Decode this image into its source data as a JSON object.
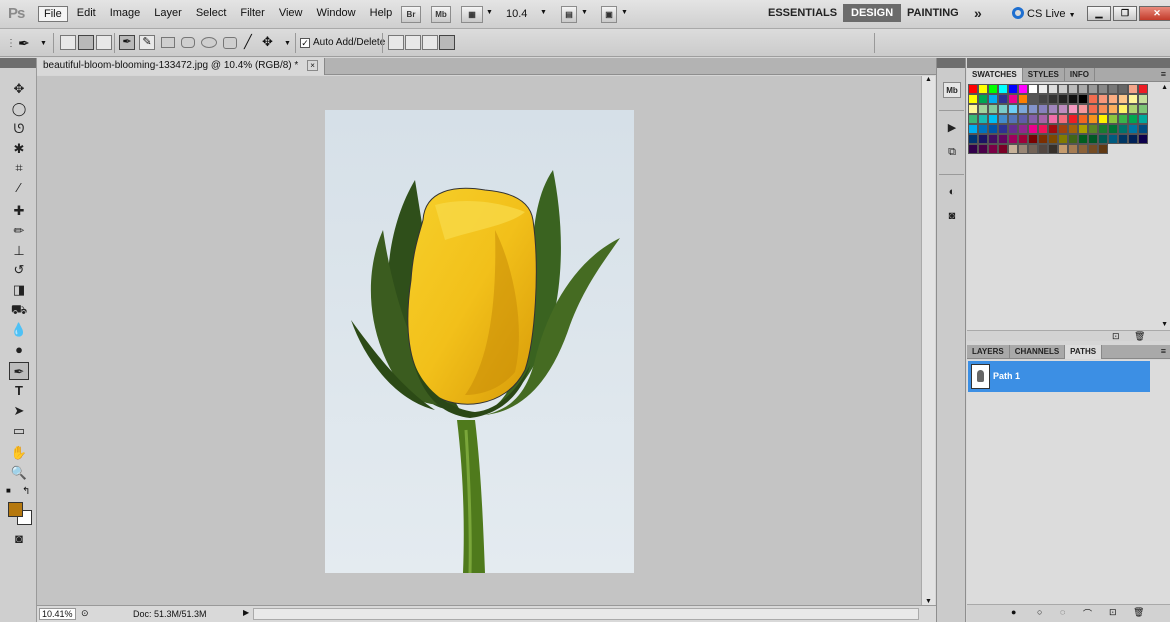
{
  "menu": {
    "items": [
      "File",
      "Edit",
      "Image",
      "Layer",
      "Select",
      "Filter",
      "View",
      "Window",
      "Help"
    ],
    "bridge_label": "Br",
    "minibridge_label": "Mb",
    "zoom_value": "10.4"
  },
  "workspaces": {
    "essentials": "ESSENTIALS",
    "design": "DESIGN",
    "painting": "PAINTING",
    "more": "»"
  },
  "cslive": {
    "label": "CS Live"
  },
  "options": {
    "auto_add_label": "Auto Add/Delete",
    "auto_add_checked": true
  },
  "document": {
    "tab_title": "beautiful-bloom-blooming-133472.jpg @ 10.4% (RGB/8) *",
    "close_label": "×"
  },
  "status": {
    "zoom": "10.41%",
    "doc_size": "Doc: 51.3M/51.3M"
  },
  "colors": {
    "foreground": "#b5780e",
    "background": "#ffffff",
    "selection": "#3c8fe4"
  },
  "swatches_panel": {
    "tabs": [
      "SWATCHES",
      "STYLES",
      "INFO"
    ],
    "active": "SWATCHES"
  },
  "paths_panel": {
    "tabs": [
      "LAYERS",
      "CHANNELS",
      "PATHS"
    ],
    "active": "PATHS",
    "paths": [
      "Path 1"
    ]
  },
  "swatch_colors": [
    "#ff0000",
    "#ffff00",
    "#00ff00",
    "#00ffff",
    "#0000ff",
    "#ff00ff",
    "#ffffff",
    "#eeeeee",
    "#dddddd",
    "#cccccc",
    "#bbbbbb",
    "#aaaaaa",
    "#999999",
    "#888888",
    "#777777",
    "#666666",
    "#f4a58a",
    "#ed1c24",
    "#ffff00",
    "#00a651",
    "#00aeef",
    "#2e3192",
    "#ec008c",
    "#ff7f00",
    "#555555",
    "#444444",
    "#333333",
    "#222222",
    "#111111",
    "#000000",
    "#f26c4f",
    "#f7977a",
    "#fbad82",
    "#fdc68a",
    "#fff79a",
    "#c4df9b",
    "#fff799",
    "#a3d39c",
    "#82ca9d",
    "#7accc8",
    "#6dcff6",
    "#7da7d9",
    "#8393ca",
    "#8781bd",
    "#a186be",
    "#bd8cbf",
    "#f49ac1",
    "#f5989d",
    "#f26c4f",
    "#f68e56",
    "#fbaf5d",
    "#fff467",
    "#acd372",
    "#7cc576",
    "#3bb878",
    "#1abbb4",
    "#00bff3",
    "#438ccb",
    "#5574b9",
    "#605ca8",
    "#855fa8",
    "#a763a8",
    "#f06eaa",
    "#f26d7d",
    "#ed1c24",
    "#f26522",
    "#f7941d",
    "#fff200",
    "#8dc63f",
    "#39b54a",
    "#00a651",
    "#00a99d",
    "#00aeef",
    "#0072bc",
    "#0054a6",
    "#2e3192",
    "#662d91",
    "#92278f",
    "#ec008c",
    "#ed145b",
    "#9e0b0f",
    "#a0410d",
    "#a3620a",
    "#aba000",
    "#598527",
    "#197b30",
    "#007236",
    "#00746b",
    "#0076a3",
    "#004b80",
    "#003471",
    "#1b1464",
    "#440e62",
    "#630460",
    "#9e005d",
    "#9e0039",
    "#790000",
    "#7b2e00",
    "#7d4900",
    "#827b00",
    "#406618",
    "#005e20",
    "#005826",
    "#005952",
    "#005b7f",
    "#003663",
    "#002157",
    "#0d004c",
    "#32004b",
    "#4b0049",
    "#7b0046",
    "#7a0026",
    "#c7b299",
    "#998675",
    "#736357",
    "#534741",
    "#37302a",
    "#c69c6d",
    "#a67c52",
    "#8c6239",
    "#754c24",
    "#603913"
  ]
}
